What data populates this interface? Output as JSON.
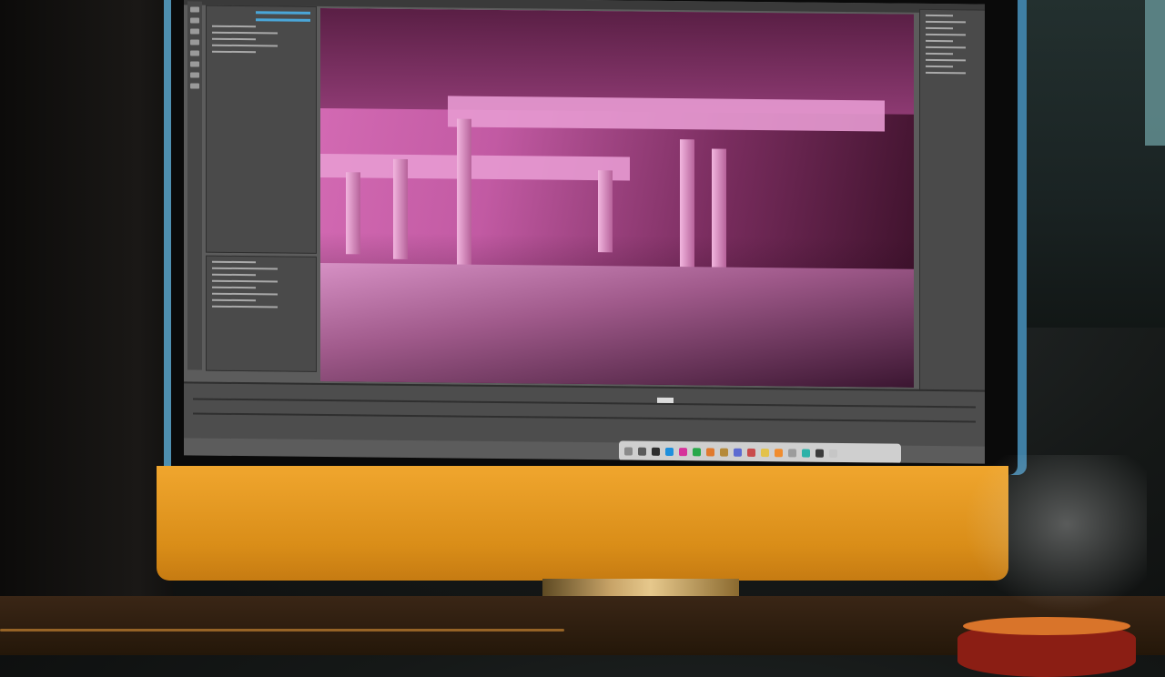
{
  "scene": {
    "description_visible_text": "",
    "colors": {
      "viewport_tint": "#d46bb4",
      "monitor_chin": "#f0a62e",
      "ui_gray": "#5c5c5c",
      "accent_blue": "#4aa6d8"
    },
    "icons": [
      "monitor-icon",
      "coffee-mug-icon",
      "dock-icon"
    ]
  },
  "dock": {
    "apps": [
      {
        "name": "app-1",
        "color": "#8a8a8a"
      },
      {
        "name": "app-2",
        "color": "#5a5a5a"
      },
      {
        "name": "app-3",
        "color": "#2f2f2f"
      },
      {
        "name": "app-4",
        "color": "#1f8fdc"
      },
      {
        "name": "app-5",
        "color": "#d6339b"
      },
      {
        "name": "app-6",
        "color": "#29a84a"
      },
      {
        "name": "app-7",
        "color": "#e07a2f"
      },
      {
        "name": "app-8",
        "color": "#b58a3a"
      },
      {
        "name": "app-9",
        "color": "#5d6bd1"
      },
      {
        "name": "app-10",
        "color": "#c94b4b"
      },
      {
        "name": "app-11",
        "color": "#e3c24a"
      },
      {
        "name": "app-12",
        "color": "#f08c2e"
      },
      {
        "name": "app-13",
        "color": "#9c9c9c"
      },
      {
        "name": "app-14",
        "color": "#2bb2a8"
      },
      {
        "name": "app-15",
        "color": "#3b3b3b"
      },
      {
        "name": "app-16",
        "color": "#c6c6c6"
      }
    ]
  }
}
